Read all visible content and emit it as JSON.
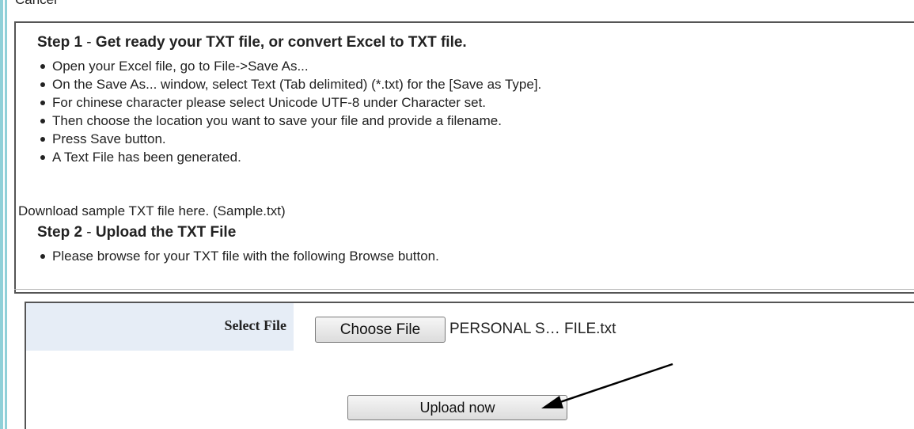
{
  "header": {
    "cancel_link": "Cancel"
  },
  "step1": {
    "label": "Step 1",
    "separator": " - ",
    "title": "Get ready your TXT file, or convert Excel to TXT file.",
    "bullets": [
      "Open your Excel file, go to File->Save As...",
      "On the Save As... window, select Text (Tab delimited) (*.txt) for the [Save as Type].",
      "For chinese character please select Unicode UTF-8 under Character set.",
      "Then choose the location you want to save your file and provide a filename.",
      "Press Save button.",
      "A Text File has been generated."
    ],
    "download_text": "Download sample TXT file here. (Sample.txt)"
  },
  "step2": {
    "label": "Step 2",
    "separator": " - ",
    "title": "Upload the TXT File",
    "bullets": [
      "Please browse for your TXT file with the following Browse button."
    ]
  },
  "upload_form": {
    "select_file_label": "Select File",
    "choose_file_button": "Choose File",
    "selected_file_name": "PERSONAL S… FILE.txt",
    "upload_button": "Upload now"
  },
  "colors": {
    "label_cell_bg": "#e6edf6",
    "left_stripe": "#8fd0d8"
  }
}
